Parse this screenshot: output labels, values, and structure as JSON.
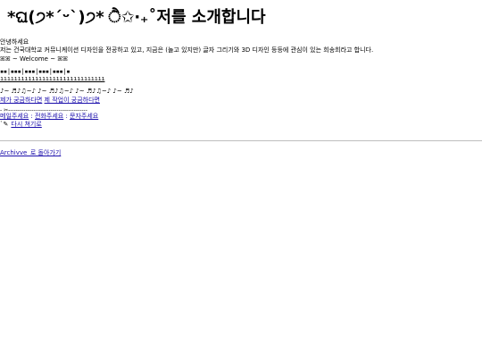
{
  "title": "*ଘ(੭*ˊᵕˋ)੭* ੈ✩‧₊˚저를 소개합니다",
  "greeting": "안녕하세요",
  "intro": "저는 건국대학교 커뮤니케이션 디자인을 전공하고 있고, 지금은 (놀고 있지만) 글자 그리기와 3D 디자인 등등에 관심이 있는 희송희라고 합니다.",
  "welcome": "ꕤꕤ ~ Welcome ~ ꕤꕤ",
  "blocks_row": "▪▪|▪▪▪|▪▪▪|▪▪▪|▪▪▪|▪",
  "ticks_row": "ıııııııııııııııııııııııııııııı",
  "music_row": "♪~ ♬♪♫~♪ ♪~ ♬♪♫~♪ ♪~ ♬♪♫~♪ ♪~ ♬♪",
  "links": {
    "about_me": "제가 궁금하다면",
    "my_work": "제 작업이 궁금하다면",
    "link_separator": " "
  },
  "dash_row": "- ✂-----------------------------------------",
  "contact": {
    "email": "메일주세요",
    "phone": "전화주세요",
    "sms": "문자주세요",
    "separator": " : "
  },
  "again": {
    "prefix": "ˋ✎",
    "label": "다시 쳐기로"
  },
  "back_link": "Archivve_로 돌아가기"
}
